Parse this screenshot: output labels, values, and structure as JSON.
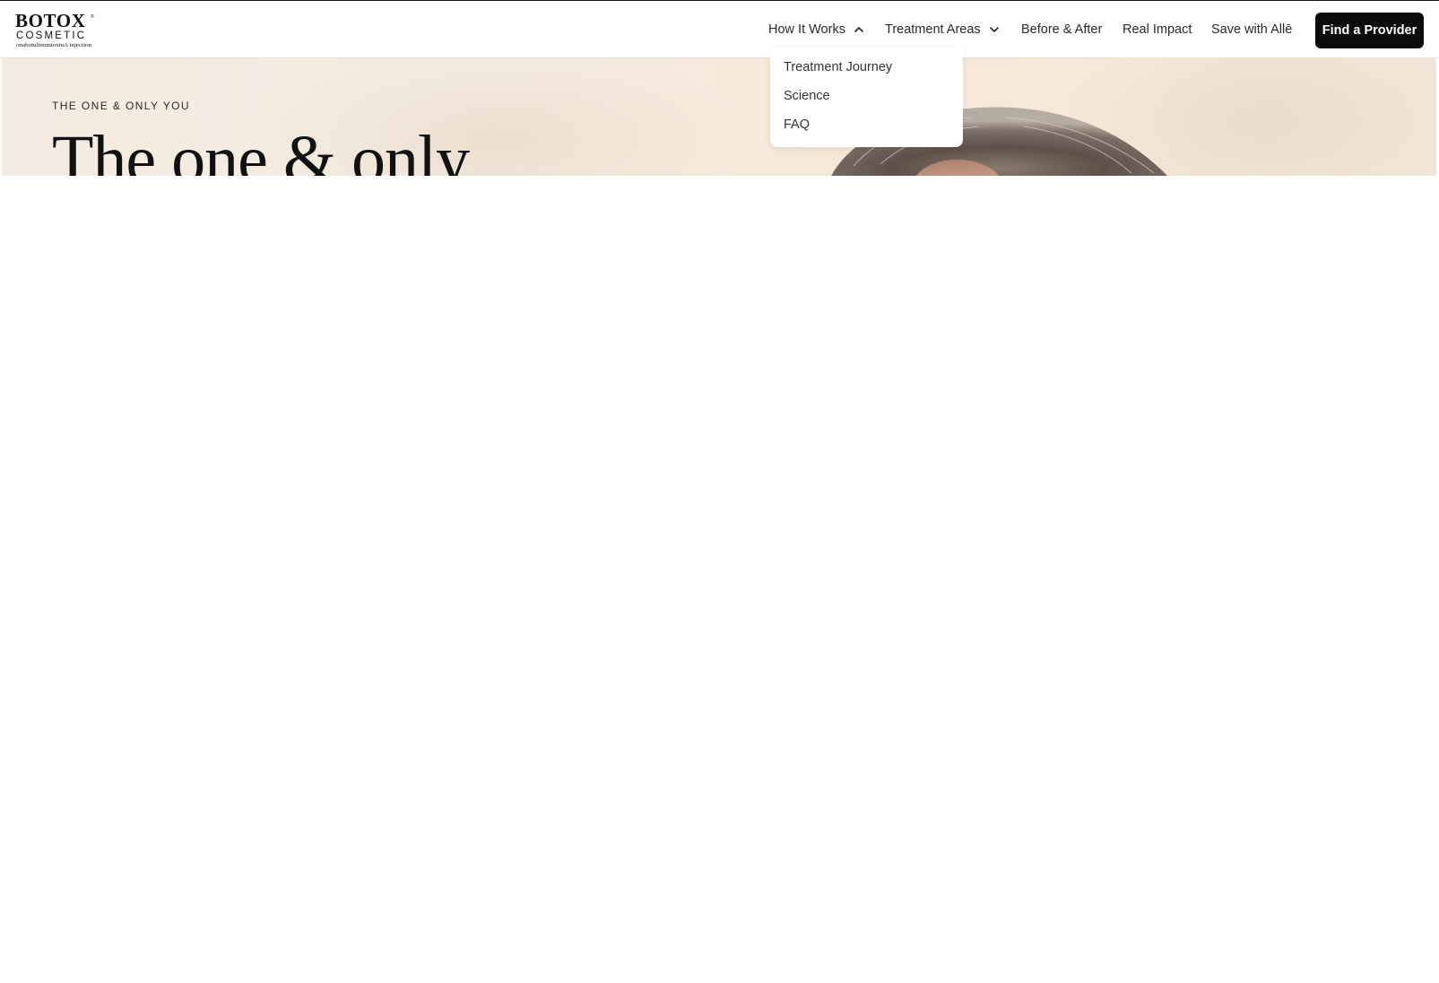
{
  "logo": {
    "brand": "BOTOX",
    "sub": "COSMETIC",
    "tagline": "onabotulinumtoxinA injection"
  },
  "nav": {
    "items": [
      {
        "label": "How It Works",
        "icon": "chevron-up-icon"
      },
      {
        "label": "Treatment Areas",
        "icon": "chevron-down-icon"
      },
      {
        "label": "Before & After"
      },
      {
        "label": "Real Impact"
      },
      {
        "label": "Save with Allē"
      }
    ],
    "cta_label": "Find a Provider"
  },
  "dropdown": {
    "items": [
      "Treatment Journey",
      "Science",
      "FAQ"
    ]
  },
  "hero": {
    "eyebrow": "THE ONE & ONLY YOU",
    "headline": "The one & only"
  },
  "colors": {
    "cta_background": "#0b0b0b",
    "hero_background": "#f4eadd",
    "text": "#1a1a1a"
  }
}
